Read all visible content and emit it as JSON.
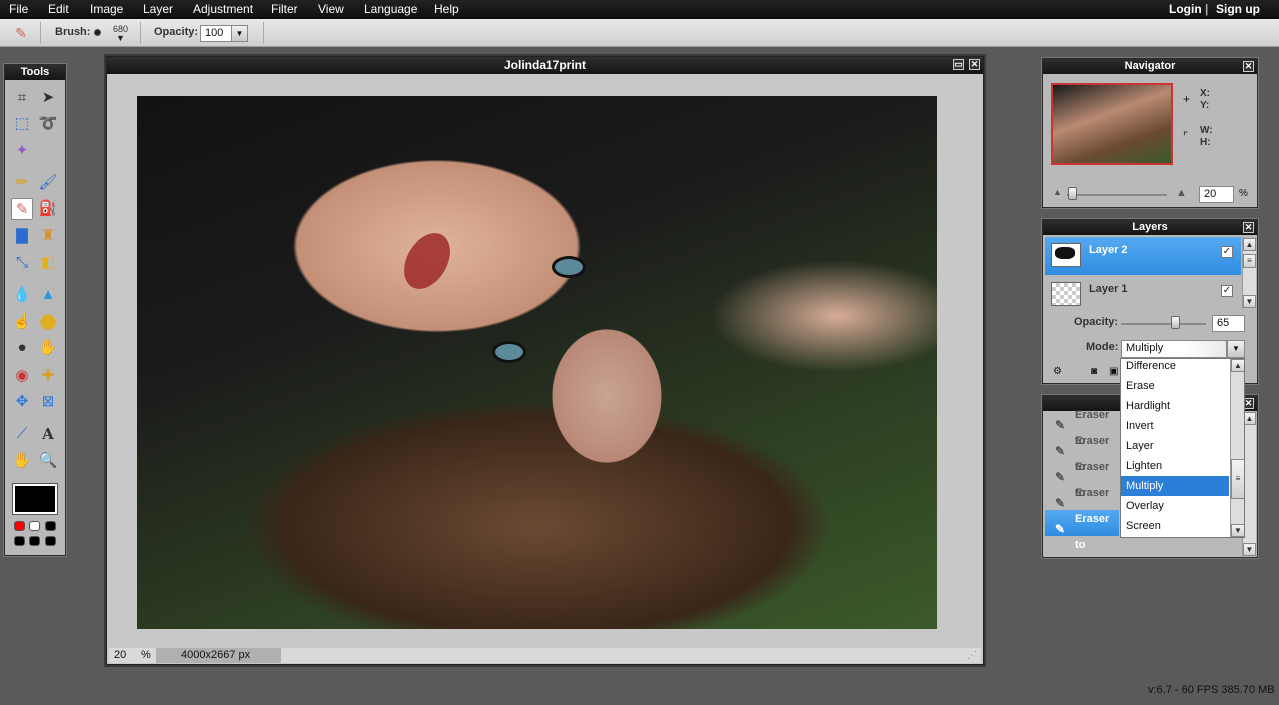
{
  "menu": {
    "items": [
      "File",
      "Edit",
      "Image",
      "Layer",
      "Adjustment",
      "Filter",
      "View",
      "Language",
      "Help"
    ],
    "login": "Login",
    "separator": "|",
    "signup": "Sign up"
  },
  "toolbar": {
    "brush_label": "Brush:",
    "brush_size": "680",
    "opacity_label": "Opacity:",
    "opacity_value": "100"
  },
  "tools": {
    "title": "Tools"
  },
  "image_window": {
    "title": "Jolinda17print",
    "zoom_value": "20",
    "zoom_unit": "%",
    "dimensions": "4000x2667 px"
  },
  "navigator": {
    "title": "Navigator",
    "x_label": "X:",
    "y_label": "Y:",
    "w_label": "W:",
    "h_label": "H:",
    "zoom_value": "20",
    "zoom_unit": "%"
  },
  "layers": {
    "title": "Layers",
    "items": [
      {
        "name": "Layer 2",
        "selected": true,
        "visible": true
      },
      {
        "name": "Layer 1",
        "selected": false,
        "visible": true
      }
    ],
    "opacity_label": "Opacity:",
    "opacity_value": "65",
    "mode_label": "Mode:",
    "mode_value": "Multiply"
  },
  "mode_dropdown": {
    "options": [
      "Difference",
      "Erase",
      "Hardlight",
      "Invert",
      "Layer",
      "Lighten",
      "Multiply",
      "Overlay",
      "Screen"
    ],
    "selected": "Multiply"
  },
  "history": {
    "items": [
      "Eraser to",
      "Eraser to",
      "Eraser to",
      "Eraser to",
      "Eraser to"
    ],
    "selected_index": 4
  },
  "footer": {
    "status": "v:6.7 - 60 FPS 385.70 MB"
  },
  "colors": {
    "selection_blue": "#2f8ce0",
    "primary_swatch": "#000000",
    "swatch_red": "#ff0000"
  }
}
